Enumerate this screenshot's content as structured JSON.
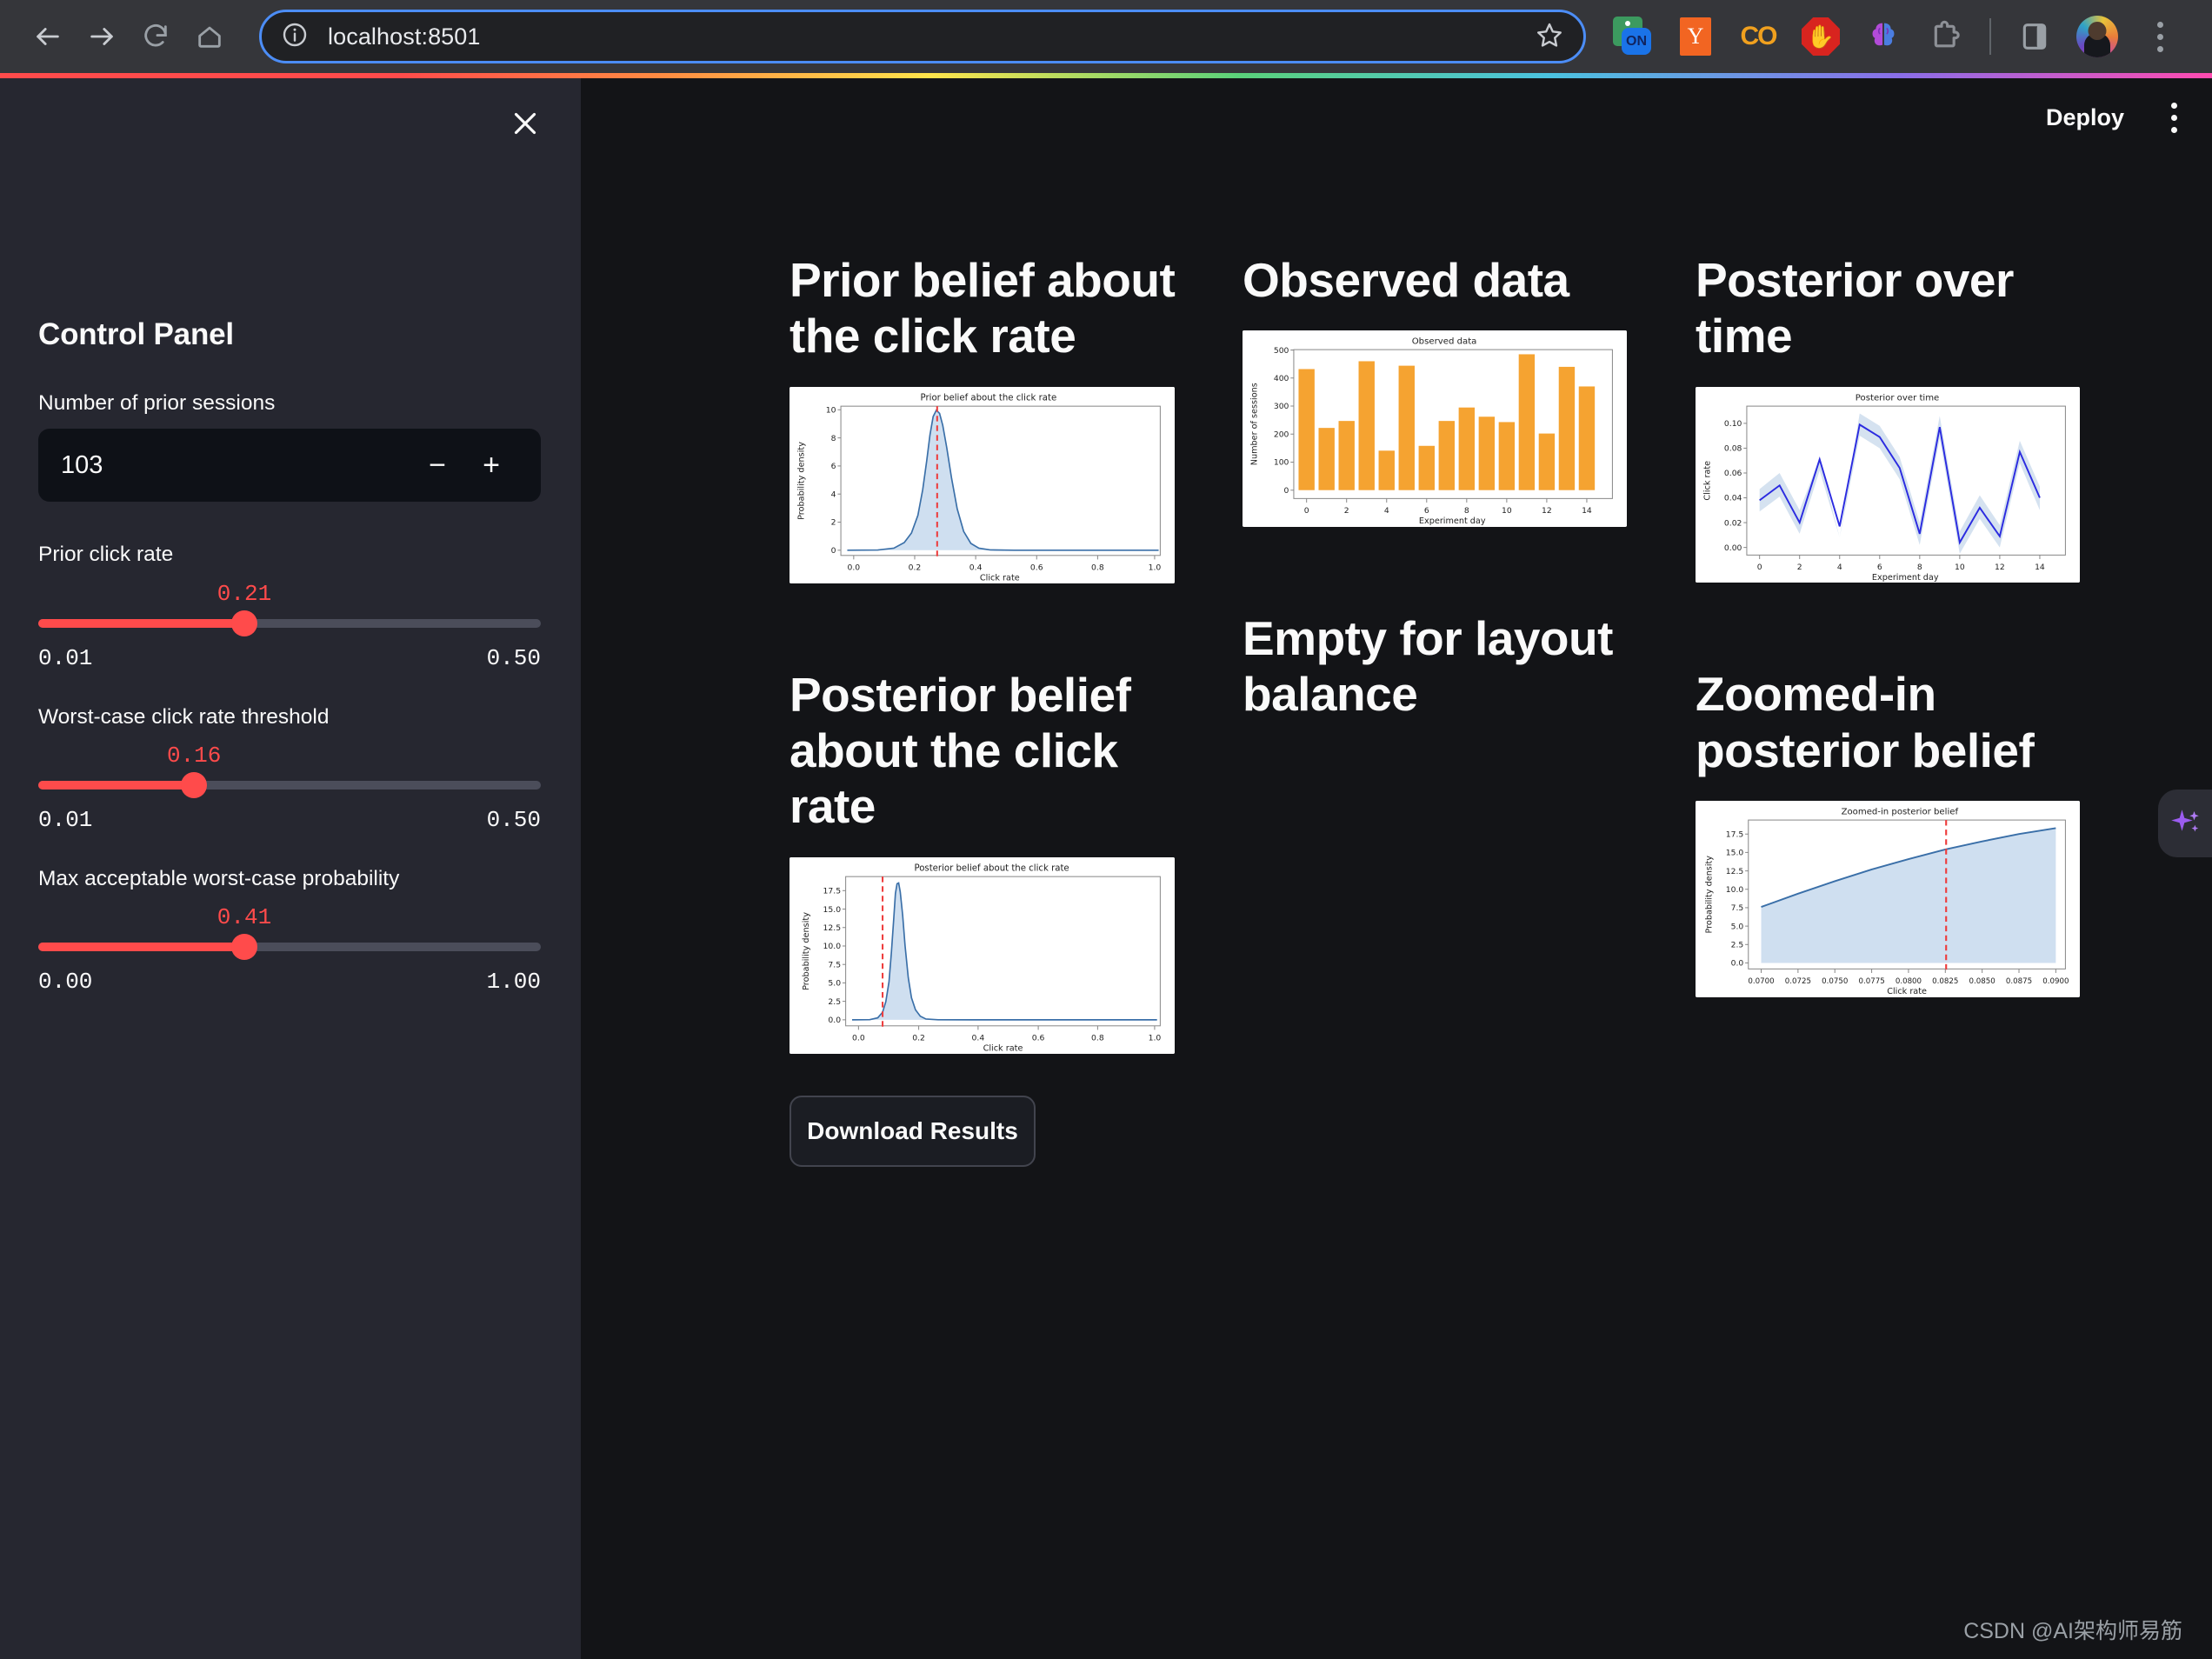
{
  "browser": {
    "nav": {
      "back": "back-arrow",
      "forward": "forward-arrow",
      "reload": "reload",
      "home": "home"
    },
    "omnibox": {
      "url": "localhost:8501",
      "info_icon": "site-info",
      "star_icon": "bookmark-star"
    },
    "extensions": [
      {
        "name": "onetab-extension",
        "label": "ON"
      },
      {
        "name": "ycombinator-extension",
        "label": "Y"
      },
      {
        "name": "co-extension",
        "label": "CO"
      },
      {
        "name": "adblock-extension",
        "label": ""
      },
      {
        "name": "brain-ai-extension",
        "label": ""
      },
      {
        "name": "extensions-puzzle",
        "label": ""
      }
    ],
    "profile": "user-avatar",
    "menu": "chrome-menu"
  },
  "app": {
    "deploy_label": "Deploy",
    "menu_label": "app-menu",
    "sidebar": {
      "close_label": "close-sidebar",
      "title": "Control Panel",
      "number_input": {
        "label": "Number of prior sessions",
        "value": "103",
        "decrement": "−",
        "increment": "+"
      },
      "sliders": [
        {
          "label": "Prior click rate",
          "value": "0.21",
          "min": "0.01",
          "max": "0.50",
          "pct": 41
        },
        {
          "label": "Worst-case click rate threshold",
          "value": "0.16",
          "min": "0.01",
          "max": "0.50",
          "pct": 31
        },
        {
          "label": "Max acceptable worst-case probability",
          "value": "0.41",
          "min": "0.00",
          "max": "1.00",
          "pct": 41
        }
      ],
      "accent_color": "#ff4b4b"
    },
    "main": {
      "headings": {
        "prior_belief": "Prior belief about the click rate",
        "observed_data": "Observed data",
        "posterior_over_time": "Posterior over time",
        "posterior_belief": "Posterior belief about the click rate",
        "empty_balance": "Empty for layout balance",
        "zoomed_posterior": "Zoomed-in posterior belief"
      },
      "download_button": "Download Results",
      "sparkle_button": "ai-assistant"
    },
    "watermark": "CSDN @AI架构师易筋"
  },
  "chart_data": [
    {
      "id": "prior-belief",
      "type": "area",
      "title": "Prior belief about the click rate",
      "xlabel": "Click rate",
      "ylabel": "Probability density",
      "xlim": [
        -0.05,
        1.05
      ],
      "ylim": [
        -0.55,
        10.6
      ],
      "xticks": [
        "0.0",
        "0.2",
        "0.4",
        "0.6",
        "0.8",
        "1.0"
      ],
      "yticks": [
        "0",
        "2",
        "4",
        "6",
        "8",
        "10"
      ],
      "line_color": "#3a6fa8",
      "fill_color": "#cfdff0",
      "vline": {
        "x": 0.21,
        "color": "#ee3b3b",
        "style": "dashed"
      },
      "distribution": {
        "kind": "beta-like",
        "mode": 0.21,
        "peak": 10.0,
        "sigma": 0.04
      },
      "grid": false
    },
    {
      "id": "observed-data",
      "type": "bar",
      "title": "Observed data",
      "xlabel": "Experiment day",
      "ylabel": "Number of sessions",
      "categories": [
        0,
        1,
        2,
        3,
        4,
        5,
        6,
        7,
        8,
        9,
        10,
        11,
        12,
        13,
        14
      ],
      "values": [
        432,
        222,
        247,
        460,
        141,
        444,
        158,
        247,
        295,
        262,
        243,
        485,
        202,
        440,
        370
      ],
      "xticks": [
        "0",
        "2",
        "4",
        "6",
        "8",
        "10",
        "12",
        "14"
      ],
      "yticks": [
        "0",
        "100",
        "200",
        "300",
        "400",
        "500"
      ],
      "ylim": [
        0,
        500
      ],
      "bar_color": "#f5a331",
      "grid": false
    },
    {
      "id": "posterior-over-time",
      "type": "line",
      "title": "Posterior over time",
      "xlabel": "Experiment day",
      "ylabel": "Click rate",
      "x": [
        0,
        1,
        2,
        3,
        4,
        5,
        6,
        7,
        8,
        9,
        10,
        11,
        12,
        13,
        14
      ],
      "values": [
        0.038,
        0.05,
        0.02,
        0.071,
        0.017,
        0.099,
        0.089,
        0.064,
        0.011,
        0.097,
        0.004,
        0.032,
        0.009,
        0.077,
        0.04
      ],
      "band_upper": [
        0.047,
        0.06,
        0.03,
        0.081,
        0.026,
        0.108,
        0.098,
        0.073,
        0.02,
        0.106,
        0.013,
        0.042,
        0.018,
        0.086,
        0.049
      ],
      "band_lower": [
        0.029,
        0.041,
        0.011,
        0.062,
        0.008,
        0.09,
        0.08,
        0.055,
        0.002,
        0.088,
        -0.005,
        0.023,
        0.0,
        0.068,
        0.03
      ],
      "xticks": [
        "0",
        "2",
        "4",
        "6",
        "8",
        "10",
        "12",
        "14"
      ],
      "yticks": [
        "0.00",
        "0.02",
        "0.04",
        "0.06",
        "0.08",
        "0.10"
      ],
      "ylim": [
        -0.012,
        0.115
      ],
      "line_color": "#2b2be0",
      "band_color": "#d5e2f0",
      "grid": false
    },
    {
      "id": "posterior-belief",
      "type": "area",
      "title": "Posterior belief about the click rate",
      "xlabel": "Click rate",
      "ylabel": "Probability density",
      "xlim": [
        -0.05,
        1.05
      ],
      "ylim": [
        -1.0,
        19.5
      ],
      "xticks": [
        "0.0",
        "0.2",
        "0.4",
        "0.6",
        "0.8",
        "1.0"
      ],
      "yticks": [
        "0.0",
        "2.5",
        "5.0",
        "7.5",
        "10.0",
        "12.5",
        "15.0",
        "17.5"
      ],
      "line_color": "#3a6fa8",
      "fill_color": "#cfdff0",
      "vline": {
        "x": 0.08,
        "color": "#ee3b3b",
        "style": "dashed"
      },
      "distribution": {
        "kind": "beta-like",
        "mode": 0.1,
        "peak": 18.4,
        "sigma": 0.021
      },
      "grid": false
    },
    {
      "id": "zoomed-posterior",
      "type": "area",
      "title": "Zoomed-in posterior belief",
      "xlabel": "Click rate",
      "ylabel": "Probability density",
      "xlim": [
        0.0695,
        0.0905
      ],
      "ylim": [
        -1.0,
        19.5
      ],
      "xticks": [
        "0.0700",
        "0.0725",
        "0.0750",
        "0.0775",
        "0.0800",
        "0.0825",
        "0.0850",
        "0.0875",
        "0.0900"
      ],
      "yticks": [
        "0.0",
        "2.5",
        "5.0",
        "7.5",
        "10.0",
        "12.5",
        "15.0",
        "17.5"
      ],
      "x": [
        0.07,
        0.0725,
        0.075,
        0.0775,
        0.08,
        0.0825,
        0.085,
        0.0875,
        0.09
      ],
      "values": [
        7.6,
        9.4,
        11.1,
        12.7,
        14.1,
        15.4,
        16.5,
        17.5,
        18.3
      ],
      "line_color": "#3a6fa8",
      "fill_color": "#cfdff0",
      "vline": {
        "x": 0.083,
        "color": "#ee3b3b",
        "style": "dashed"
      },
      "grid": false
    }
  ]
}
